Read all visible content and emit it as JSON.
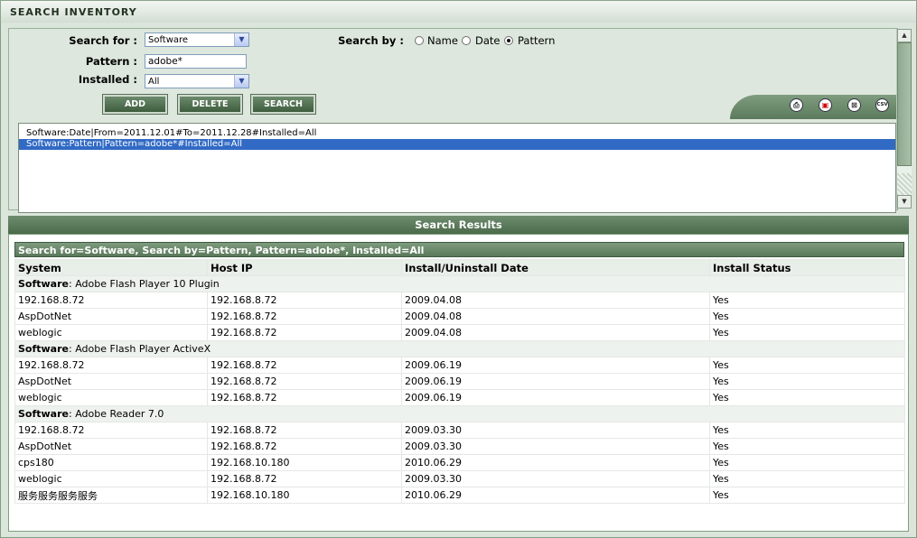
{
  "title": "SEARCH INVENTORY",
  "form": {
    "search_for_label": "Search for :",
    "search_for_value": "Software",
    "pattern_label": "Pattern :",
    "pattern_value": "adobe*",
    "installed_label": "Installed :",
    "installed_value": "All",
    "search_by_label": "Search by :",
    "search_by_options": [
      "Name",
      "Date",
      "Pattern"
    ],
    "search_by_selected": "Pattern",
    "buttons": {
      "add": "ADD",
      "delete": "DELETE",
      "search": "SEARCH"
    }
  },
  "toolbar_icons": [
    "printer-icon",
    "pdf-icon",
    "excel-icon",
    "csv-icon"
  ],
  "toolbar_icon_labels": {
    "csv": "CSV"
  },
  "criteria": [
    {
      "text": "Software:Date|From=2011.12.01#To=2011.12.28#Installed=All",
      "selected": false
    },
    {
      "text": "Software:Pattern|Pattern=adobe*#Installed=All",
      "selected": true
    }
  ],
  "results": {
    "header": "Search Results",
    "summary": "Search for=Software, Search by=Pattern, Pattern=adobe*, Installed=All",
    "columns": [
      "System",
      "Host IP",
      "Install/Uninstall Date",
      "Install Status"
    ],
    "group_label": "Software",
    "groups": [
      {
        "name": "Adobe Flash Player 10 Plugin",
        "rows": [
          [
            "192.168.8.72",
            "192.168.8.72",
            "2009.04.08",
            "Yes"
          ],
          [
            "AspDotNet",
            "192.168.8.72",
            "2009.04.08",
            "Yes"
          ],
          [
            "weblogic",
            "192.168.8.72",
            "2009.04.08",
            "Yes"
          ]
        ]
      },
      {
        "name": "Adobe Flash Player ActiveX",
        "rows": [
          [
            "192.168.8.72",
            "192.168.8.72",
            "2009.06.19",
            "Yes"
          ],
          [
            "AspDotNet",
            "192.168.8.72",
            "2009.06.19",
            "Yes"
          ],
          [
            "weblogic",
            "192.168.8.72",
            "2009.06.19",
            "Yes"
          ]
        ]
      },
      {
        "name": "Adobe Reader 7.0",
        "rows": [
          [
            "192.168.8.72",
            "192.168.8.72",
            "2009.03.30",
            "Yes"
          ],
          [
            "AspDotNet",
            "192.168.8.72",
            "2009.03.30",
            "Yes"
          ],
          [
            "cps180",
            "192.168.10.180",
            "2010.06.29",
            "Yes"
          ],
          [
            "weblogic",
            "192.168.8.72",
            "2009.03.30",
            "Yes"
          ],
          [
            "服务服务服务服务",
            "192.168.10.180",
            "2010.06.29",
            "Yes"
          ]
        ]
      }
    ]
  }
}
